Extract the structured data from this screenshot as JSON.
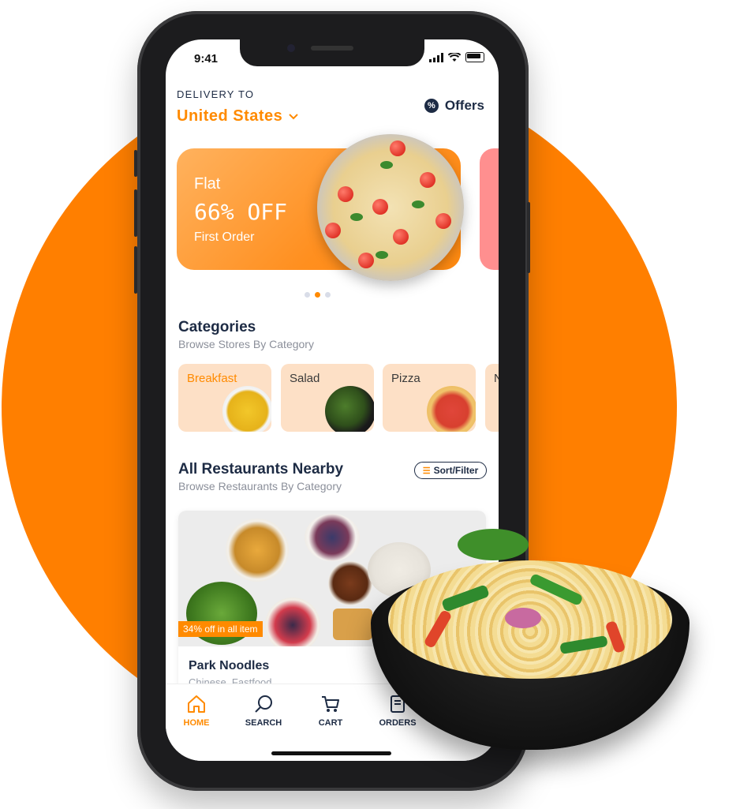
{
  "status_bar": {
    "time": "9:41"
  },
  "header": {
    "delivery_label": "DELIVERY TO",
    "location": "United States",
    "location_chevron": "chevron-down-icon",
    "offers_label": "Offers",
    "offers_icon": "percent-badge-icon"
  },
  "banner": {
    "line1": "Flat",
    "line2": "66% OFF",
    "line3": "First Order",
    "active_dot": 2,
    "dot_count": 3
  },
  "categories": {
    "title": "Categories",
    "subtitle": "Browse Stores By Category",
    "items": [
      {
        "label": "Breakfast",
        "active": true
      },
      {
        "label": "Salad",
        "active": false
      },
      {
        "label": "Pizza",
        "active": false
      },
      {
        "label": "N",
        "active": false
      }
    ]
  },
  "restaurants": {
    "title": "All Restaurants Nearby",
    "subtitle": "Browse Restaurants By Category",
    "sort_filter_label": "Sort/Filter",
    "items": [
      {
        "offer_tag": "34% off in all item",
        "name": "Park Noodles",
        "cuisine": "Chinese, Fastfood"
      }
    ]
  },
  "tabbar": {
    "items": [
      {
        "label": "HOME",
        "icon": "home-icon",
        "active": true
      },
      {
        "label": "SEARCH",
        "icon": "search-icon",
        "active": false
      },
      {
        "label": "CART",
        "icon": "cart-icon",
        "active": false
      },
      {
        "label": "ORDERS",
        "icon": "orders-icon",
        "active": false
      }
    ]
  },
  "colors": {
    "accent": "#FF8A00",
    "background_circle": "#FF7F00",
    "text_dark": "#1d2b44"
  }
}
